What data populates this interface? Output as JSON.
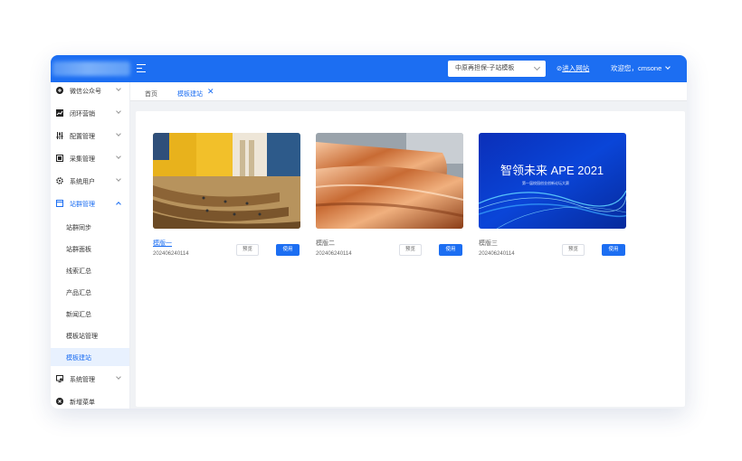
{
  "colors": {
    "accent": "#1c6ef2",
    "active_bg": "#e8f1fe",
    "page_bg": "#f0f2f5"
  },
  "header": {
    "site_select_value": "中原再担保-子站模板",
    "enter_site_label": "进入网站",
    "greeting": "欢迎您，cmsone"
  },
  "sidebar": {
    "items": [
      {
        "label": "微信公众号",
        "icon": "plus-circle-icon"
      },
      {
        "label": "闭环营销",
        "icon": "chart-icon"
      },
      {
        "label": "配置管理",
        "icon": "sliders-icon"
      },
      {
        "label": "采集管理",
        "icon": "collect-icon"
      },
      {
        "label": "系统用户",
        "icon": "gear-icon"
      },
      {
        "label": "站群管理",
        "icon": "window-icon"
      }
    ],
    "subitems": [
      {
        "label": "站群同步"
      },
      {
        "label": "站群面板"
      },
      {
        "label": "线索汇总"
      },
      {
        "label": "产品汇总"
      },
      {
        "label": "新闻汇总"
      },
      {
        "label": "模板站管理"
      },
      {
        "label": "模板建站"
      }
    ],
    "bottom_items": [
      {
        "label": "系统管理",
        "icon": "monitor-gear-icon"
      },
      {
        "label": "新增菜单",
        "icon": "x-circle-icon"
      }
    ]
  },
  "tabs": {
    "home": "首页",
    "current": "模板建站",
    "close_glyph": "✕"
  },
  "cards": [
    {
      "name": "模版一",
      "date": "202406240114",
      "preview_label": "预览",
      "use_label": "使用",
      "image": "auditorium"
    },
    {
      "name": "模版二",
      "date": "202406240114",
      "preview_label": "预览",
      "use_label": "使用",
      "image": "copper-foil-roll"
    },
    {
      "name": "模版三",
      "date": "202406240114",
      "preview_label": "预览",
      "use_label": "使用",
      "image": "blue-tech-banner",
      "banner_title": "智领未来 APE 2021",
      "banner_subtitle": "第一届校园创业创新论坛大赛"
    }
  ]
}
